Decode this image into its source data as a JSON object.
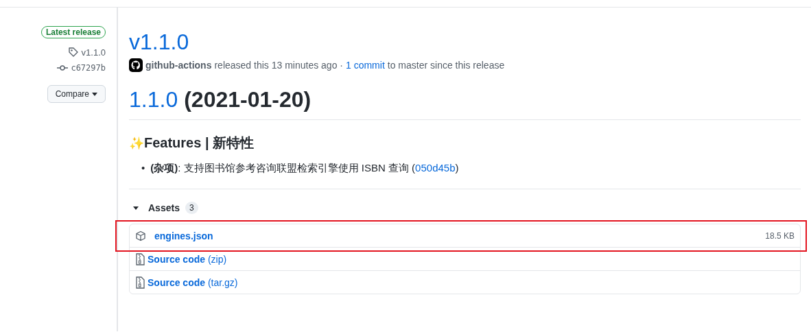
{
  "sidebar": {
    "badge": "Latest release",
    "tag": "v1.1.0",
    "commit": "c67297b",
    "compare_button": "Compare"
  },
  "release": {
    "title": "v1.1.0",
    "author": "github-actions",
    "meta_text": "released this 13 minutes ago ·",
    "commits_link": "1 commit",
    "meta_tail": "to master since this release"
  },
  "notes": {
    "version_link": "1.1.0",
    "date": "(2021-01-20)",
    "section_emoji": "✨",
    "section_title": "Features | 新特性",
    "items": [
      {
        "bullet": "•",
        "text": "**(杂项)**: 支持图书馆参考咨询联盟检索引擎使用 ISBN 查询 (",
        "link": "050d45b",
        "tail": ")"
      }
    ]
  },
  "assets": {
    "label": "Assets",
    "count": "3",
    "expanded": true,
    "items": [
      {
        "kind": "package",
        "name": "**engines.json**",
        "size": "18.5 KB",
        "highlighted": true
      },
      {
        "kind": "archive",
        "name": "**Source code** (zip)",
        "highlighted": false
      },
      {
        "kind": "archive",
        "name": "**Source code** (tar.gz)",
        "highlighted": false
      }
    ]
  }
}
